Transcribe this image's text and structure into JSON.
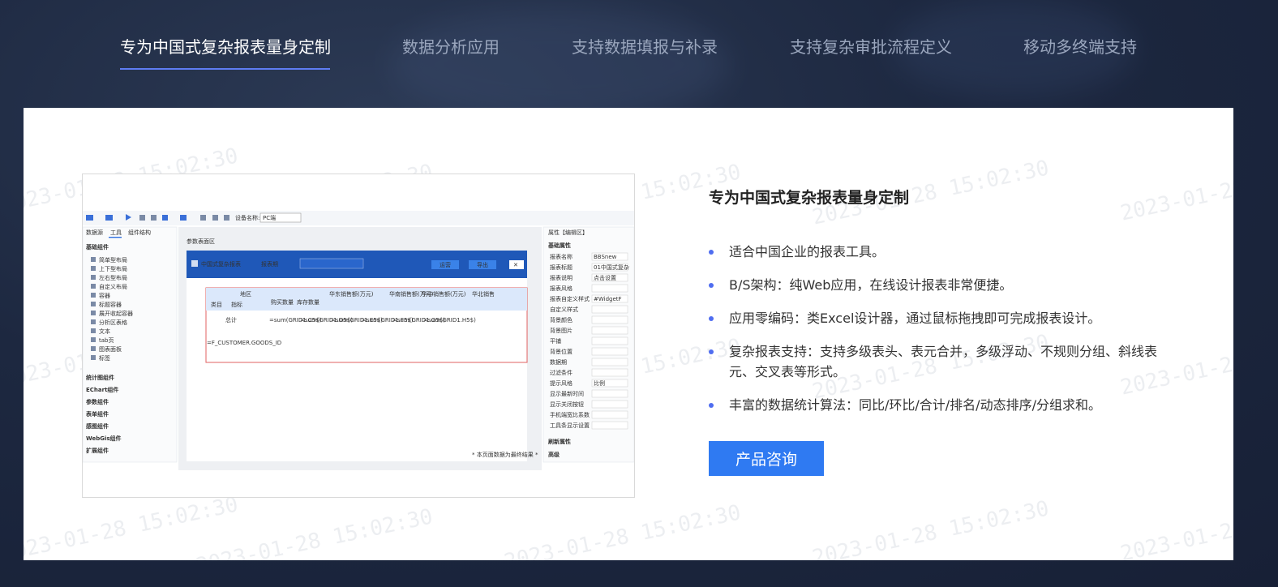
{
  "tabs": [
    {
      "label": "专为中国式复杂报表量身定制",
      "active": true
    },
    {
      "label": "数据分析应用",
      "active": false
    },
    {
      "label": "支持数据填报与补录",
      "active": false
    },
    {
      "label": "支持复杂审批流程定义",
      "active": false
    },
    {
      "label": "移动多终端支持",
      "active": false
    }
  ],
  "watermark": "2023-01-28 15:02:30",
  "panel": {
    "title": "专为中国式复杂报表量身定制",
    "features": [
      "适合中国企业的报表工具。",
      "B/S架构：纯Web应用，在线设计报表非常便捷。",
      "应用零编码：类Excel设计器，通过鼠标拖拽即可完成报表设计。",
      "复杂报表支持：支持多级表头、表元合并，多级浮动、不规则分组、斜线表元、交叉表等形式。",
      "丰富的数据统计算法：同比/环比/合计/排名/动态排序/分组求和。"
    ],
    "cta_label": "产品咨询"
  },
  "screenshot": {
    "toolbar_device_label": "设备名称:",
    "toolbar_device_value": "PC端",
    "left_tabs": [
      "数据源",
      "工具",
      "组件结构"
    ],
    "left_section": "基础组件",
    "left_items": [
      "简单型布局",
      "上下型布局",
      "左右型布局",
      "自定义布局",
      "容器",
      "标题容器",
      "展开收起容器",
      "分析区表格",
      "文本",
      "tab页",
      "图表面板",
      "标签"
    ],
    "left_groups": [
      "统计图组件",
      "EChart组件",
      "参数组件",
      "表单组件",
      "感图组件",
      "WebGis组件",
      "扩展组件"
    ],
    "canvas_caption": "参数表面区",
    "report_title": "中国式复杂报表",
    "report_param_label": "报表期",
    "report_btn_query": "运营",
    "report_btn_export": "导出",
    "table_headers": [
      "地区",
      "类目",
      "指标",
      "购买数量",
      "库存数量",
      "华东销售额(万元)",
      "华南销售额(万元)",
      "华中销售额(万元)",
      "华北销售"
    ],
    "table_row1": [
      "总计",
      "=sum(GRID1.C5$)",
      "=sum(GRID1.D5$)",
      "=sum(GRID1.E5$)",
      "=sum(GRID1.F5$)",
      "=sum(GRID1.G5$)",
      "=sum(GRID1.H5$)"
    ],
    "table_row2_label": "=F_CUSTOMER.GOODS_ID",
    "table_footer": "* 本页面数据为最终结果 *",
    "right_header": "属性【编辑区】",
    "right_section": "基础属性",
    "right_props": [
      "报表名称",
      "报表标题",
      "报表说明",
      "报表风格",
      "报表自定义样式",
      "自定义样式",
      "背景颜色",
      "背景图片",
      "平铺",
      "背景位置",
      "数据期",
      "过滤条件",
      "提示风格",
      "显示最新时间",
      "显示关闭按钮",
      "手机端宽比系数",
      "工具条显示设置"
    ],
    "right_values": [
      "BBSnew",
      "01中国式复杂",
      "点击设置",
      "#WidgetF",
      "比例"
    ],
    "right_groups": [
      "刷新属性",
      "高级"
    ]
  }
}
